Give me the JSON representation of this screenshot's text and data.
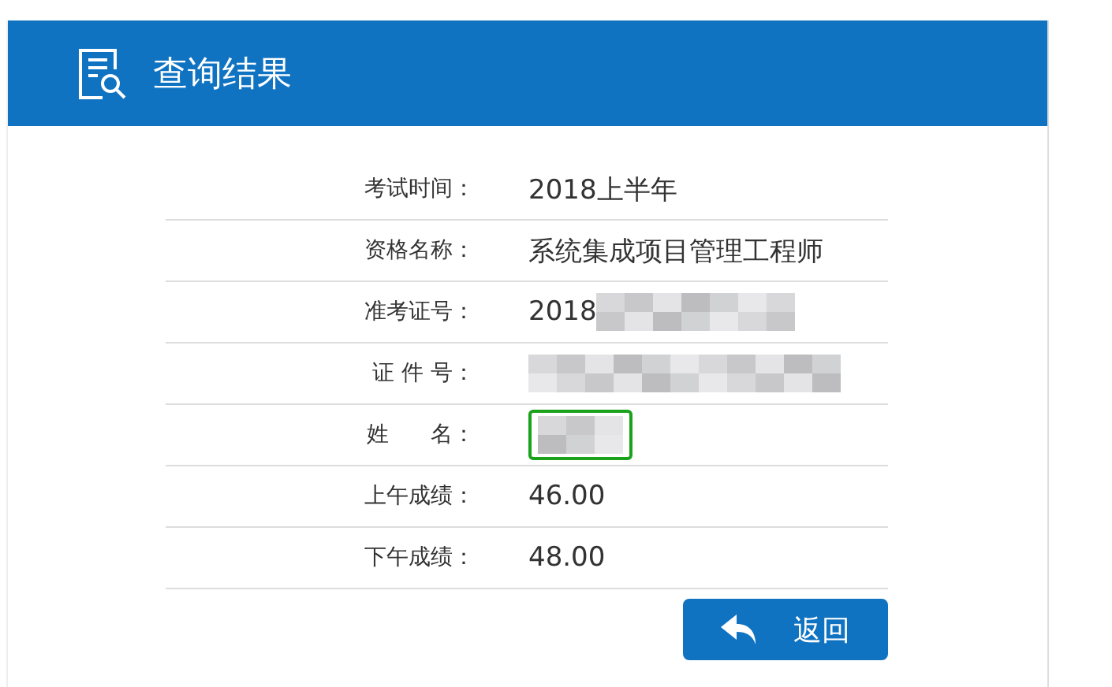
{
  "header": {
    "title": "查询结果"
  },
  "rows": [
    {
      "label": "考试时间：",
      "value": "2018上半年",
      "redacted": false,
      "highlighted": false
    },
    {
      "label": "资格名称：",
      "value": "系统集成项目管理工程师",
      "redacted": false,
      "highlighted": false
    },
    {
      "label": "准考证号：",
      "value": "2018",
      "redacted": true,
      "highlighted": false
    },
    {
      "label": "证 件 号：",
      "redacted": true,
      "highlighted": false
    },
    {
      "label": "姓      名：",
      "redacted": true,
      "highlighted": true
    },
    {
      "label": "上午成绩：",
      "value": "46.00",
      "redacted": false,
      "highlighted": false
    },
    {
      "label": "下午成绩：",
      "value": "48.00",
      "redacted": false,
      "highlighted": false
    }
  ],
  "back_button": {
    "label": "返回"
  }
}
